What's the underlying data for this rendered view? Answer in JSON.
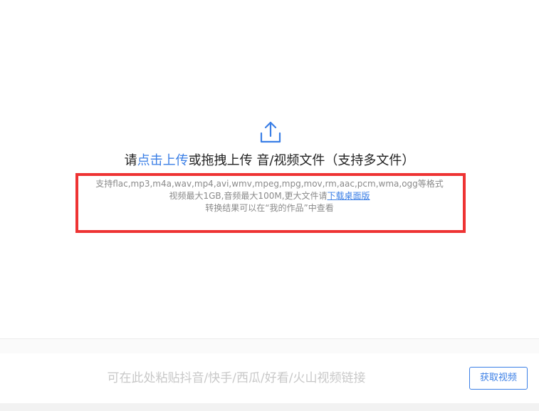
{
  "upload": {
    "icon": "upload-icon",
    "prompt_prefix": "请",
    "prompt_link": "点击上传",
    "prompt_suffix": "或拖拽上传 音/视频文件（支持多文件）",
    "formats_line": "支持flac,mp3,m4a,wav,mp4,avi,wmv,mpeg,mpg,mov,rm,aac,pcm,wma,ogg等格式",
    "limits_prefix": "视频最大1GB,音频最大100M,更大文件请",
    "limits_link": "下载桌面版",
    "result_line": "转换结果可以在“我的作品”中查看"
  },
  "link_bar": {
    "placeholder": "可在此处粘贴抖音/快手/西瓜/好看/火山视频链接",
    "value": "",
    "button_label": "获取视频"
  },
  "colors": {
    "accent": "#3b7fe6",
    "highlight_border": "#ee3333",
    "muted_text": "#8a8a8a"
  }
}
